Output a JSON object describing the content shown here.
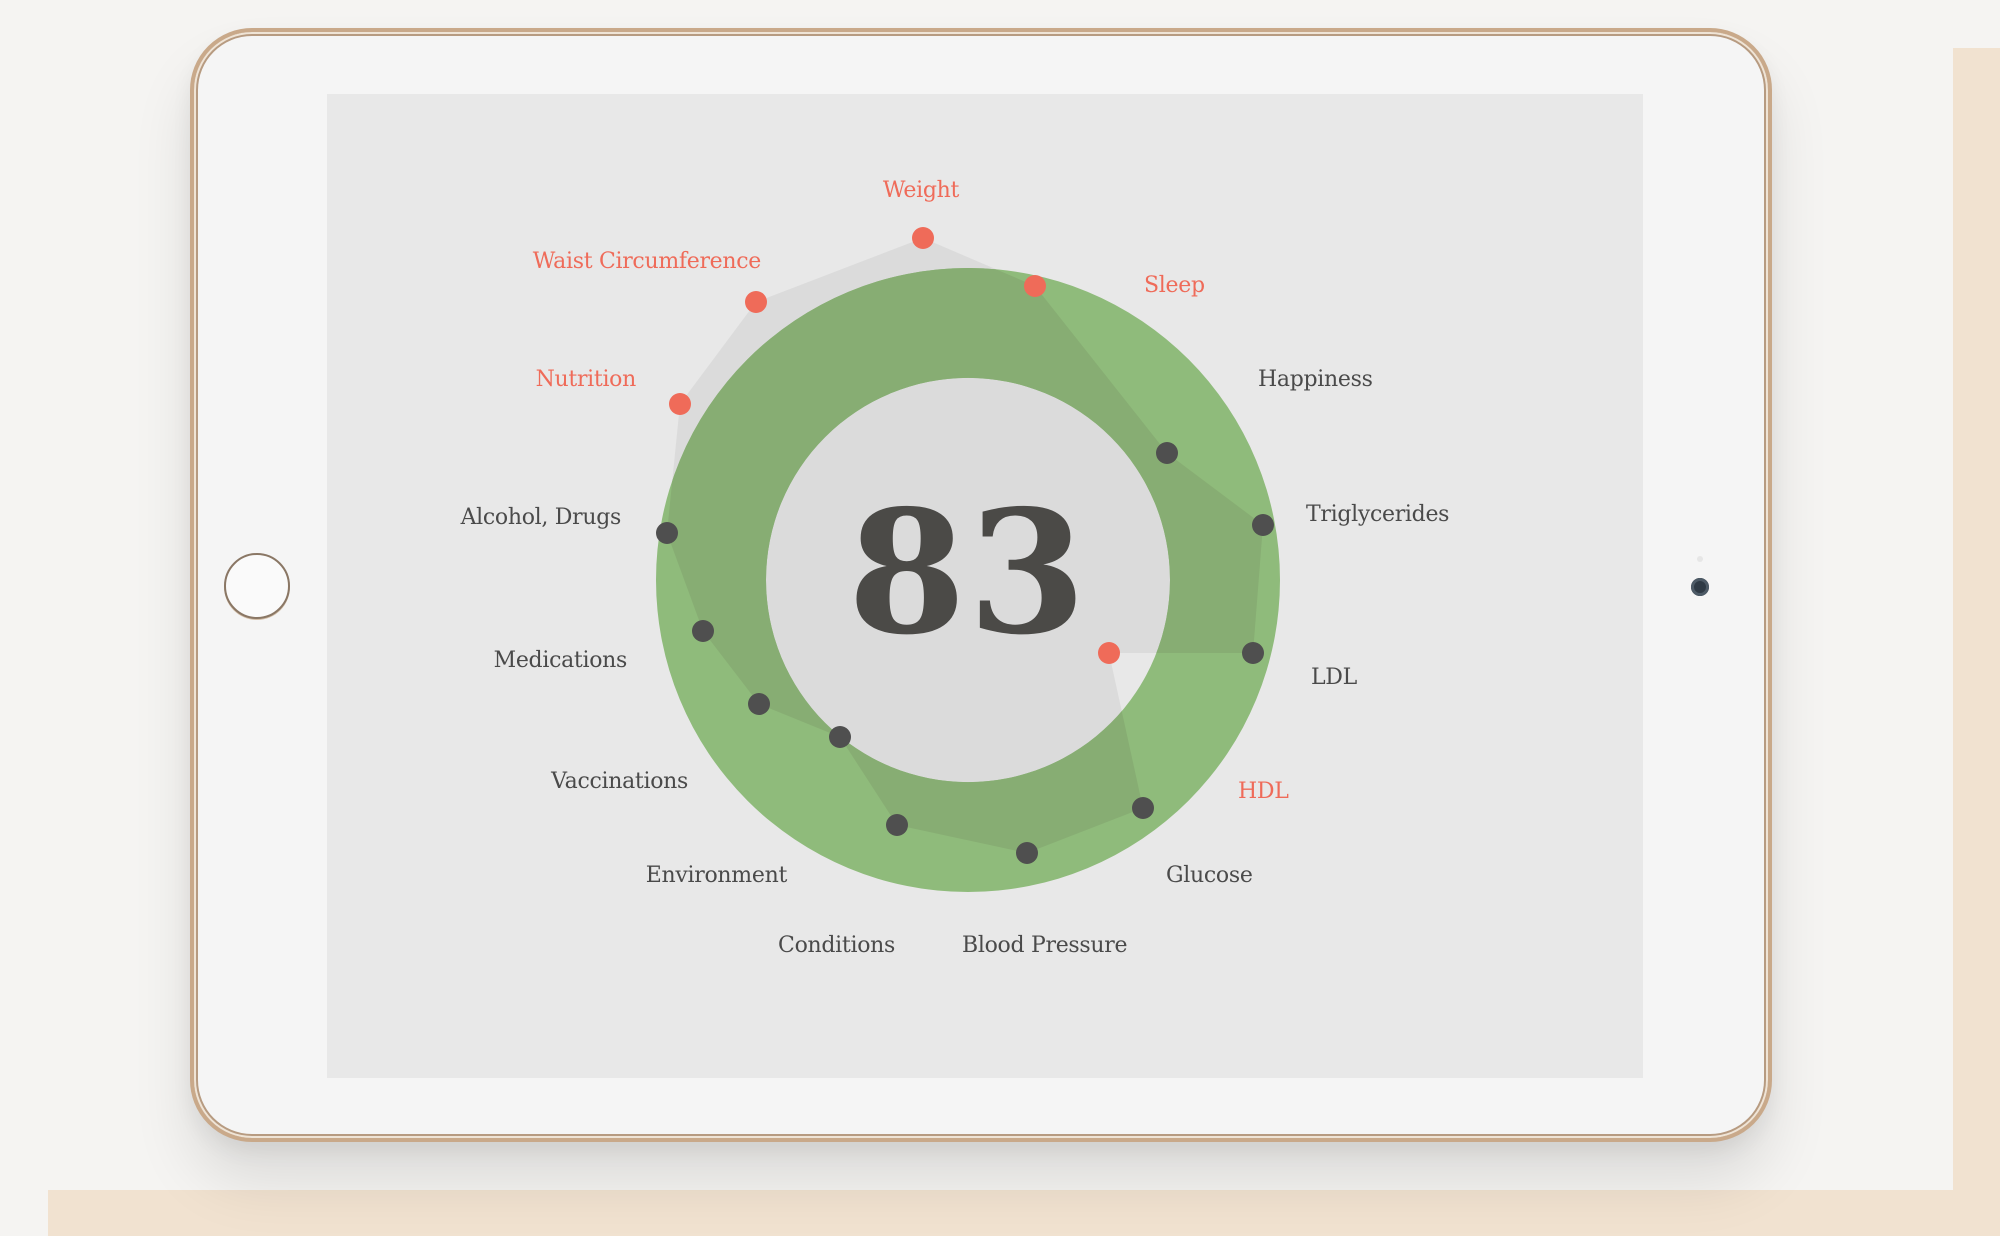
{
  "score": "83",
  "colors": {
    "alert": "#ef6b59",
    "normal": "#4f4f4f",
    "ring": "#8fbb7b",
    "ring_overlap": "#87ad73",
    "shape": "#d9d9d9"
  },
  "metrics": [
    {
      "label": "Weight",
      "status": "alert"
    },
    {
      "label": "Sleep",
      "status": "alert"
    },
    {
      "label": "Happiness",
      "status": "normal"
    },
    {
      "label": "Triglycerides",
      "status": "normal"
    },
    {
      "label": "LDL",
      "status": "normal"
    },
    {
      "label": "HDL",
      "status": "alert"
    },
    {
      "label": "Glucose",
      "status": "normal"
    },
    {
      "label": "Blood Pressure",
      "status": "normal"
    },
    {
      "label": "Conditions",
      "status": "normal"
    },
    {
      "label": "Environment",
      "status": "normal"
    },
    {
      "label": "Vaccinations",
      "status": "normal"
    },
    {
      "label": "Medications",
      "status": "normal"
    },
    {
      "label": "Alcohol, Drugs",
      "status": "normal"
    },
    {
      "label": "Nutrition",
      "status": "alert"
    },
    {
      "label": "Waist Circumference",
      "status": "alert"
    }
  ]
}
